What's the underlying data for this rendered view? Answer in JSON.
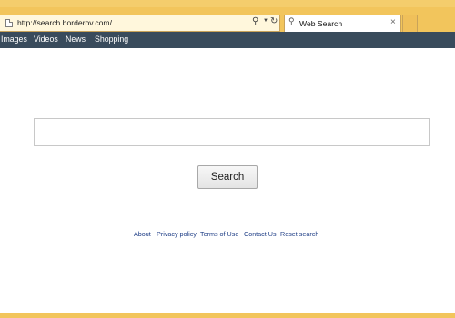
{
  "browser": {
    "address_url": "http://search.borderov.com/",
    "tab_title": "Web Search"
  },
  "nav": {
    "items": [
      {
        "label": "Images"
      },
      {
        "label": "Videos"
      },
      {
        "label": "News"
      },
      {
        "label": "Shopping"
      }
    ]
  },
  "search": {
    "input_value": "",
    "button_label": "Search"
  },
  "footer": {
    "links": [
      {
        "label": "About"
      },
      {
        "label": "Privacy policy"
      },
      {
        "label": "Terms of Use"
      },
      {
        "label": "Contact Us"
      },
      {
        "label": "Reset search"
      }
    ]
  },
  "colors": {
    "chrome": "#f2c55c",
    "navbar": "#394b5c",
    "link": "#1f3e86"
  }
}
